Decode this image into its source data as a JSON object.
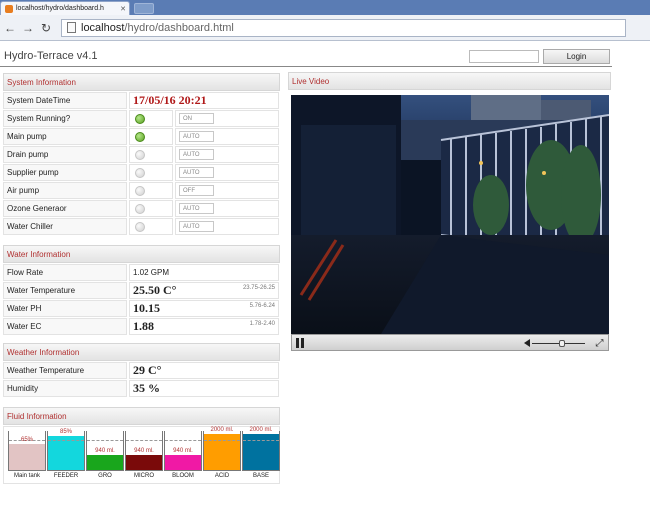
{
  "browser": {
    "tab_title": "localhost/hydro/dashboard.h",
    "url_host": "localhost",
    "url_path": "/hydro/dashboard.html"
  },
  "header": {
    "app_title": "Hydro-Terrace v4.1",
    "login_label": "Login",
    "login_placeholder": ""
  },
  "system": {
    "section_title": "System Information",
    "datetime_label": "System DateTime",
    "datetime_value": "17/05/16 20:21",
    "devices": [
      {
        "label": "System Running?",
        "on": true,
        "mode": "ON"
      },
      {
        "label": "Main pump",
        "on": true,
        "mode": "AUTO"
      },
      {
        "label": "Drain pump",
        "on": false,
        "mode": "AUTO"
      },
      {
        "label": "Supplier pump",
        "on": false,
        "mode": "AUTO"
      },
      {
        "label": "Air pump",
        "on": false,
        "mode": "OFF"
      },
      {
        "label": "Ozone Generaor",
        "on": false,
        "mode": "AUTO"
      },
      {
        "label": "Water Chiller",
        "on": false,
        "mode": "AUTO"
      }
    ]
  },
  "water": {
    "section_title": "Water Information",
    "flow_label": "Flow Rate",
    "flow_value": "1.02 GPM",
    "temp_label": "Water Temperature",
    "temp_value": "25.50 C°",
    "temp_range": "23.75-26.25",
    "ph_label": "Water PH",
    "ph_value": "10.15",
    "ph_range": "5.76-6.24",
    "ec_label": "Water EC",
    "ec_value": "1.88",
    "ec_range": "1.78-2.40"
  },
  "weather": {
    "section_title": "Weather Information",
    "temp_label": "Weather Temperature",
    "temp_value": "29 C°",
    "humidity_label": "Humidity",
    "humidity_value": "35 %"
  },
  "fluid": {
    "section_title": "Fluid Information",
    "tanks": [
      {
        "label": "Main tank",
        "text": "65%",
        "level": 0.65,
        "color": "#e2c4c4"
      },
      {
        "label": "FEEDER",
        "text": "85%",
        "level": 0.85,
        "color": "#13d7dd"
      },
      {
        "label": "GRO",
        "text": "940 ml.",
        "level": 0.38,
        "color": "#19a61c"
      },
      {
        "label": "MICRO",
        "text": "940 ml.",
        "level": 0.38,
        "color": "#7a0a0a"
      },
      {
        "label": "BLOOM",
        "text": "940 ml.",
        "level": 0.38,
        "color": "#f019a5"
      },
      {
        "label": "ACID",
        "text": "2000 ml.",
        "level": 0.9,
        "color": "#ff9d00"
      },
      {
        "label": "BASE",
        "text": "2000 ml.",
        "level": 0.9,
        "color": "#00729f"
      }
    ]
  },
  "video": {
    "section_title": "Live Video"
  },
  "colors": {
    "section_header_text": "#b03030",
    "led_on": "#5aa022"
  }
}
